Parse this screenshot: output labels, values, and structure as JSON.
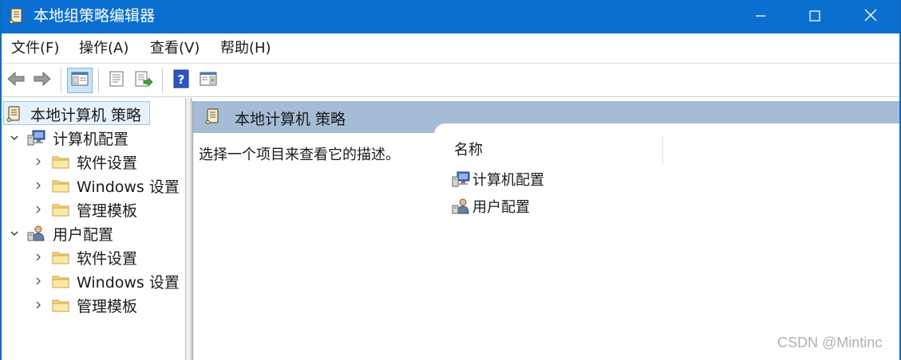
{
  "window": {
    "title": "本地组策略编辑器",
    "accent": "#0b6fd1",
    "controls": {
      "minimize": "minimize-icon",
      "maximize": "maximize-icon",
      "close": "close-icon"
    }
  },
  "menu": {
    "items": [
      "文件(F)",
      "操作(A)",
      "查看(V)",
      "帮助(H)"
    ]
  },
  "toolbar": {
    "buttons": [
      "back-arrow-icon",
      "forward-arrow-icon",
      "show-hide-tree-icon",
      "properties-icon",
      "export-list-icon",
      "help-icon",
      "action-pane-icon"
    ]
  },
  "tree": {
    "root": {
      "label": "本地计算机 策略",
      "icon": "policy-scroll-icon"
    },
    "nodes": [
      {
        "label": "计算机配置",
        "icon": "computer-config-icon",
        "expanded": true,
        "children": [
          {
            "label": "软件设置",
            "icon": "folder-icon"
          },
          {
            "label": "Windows 设置",
            "icon": "folder-icon"
          },
          {
            "label": "管理模板",
            "icon": "folder-icon"
          }
        ]
      },
      {
        "label": "用户配置",
        "icon": "user-config-icon",
        "expanded": true,
        "children": [
          {
            "label": "软件设置",
            "icon": "folder-icon"
          },
          {
            "label": "Windows 设置",
            "icon": "folder-icon"
          },
          {
            "label": "管理模板",
            "icon": "folder-icon"
          }
        ]
      }
    ]
  },
  "content": {
    "header_title": "本地计算机 策略",
    "description": "选择一个项目来查看它的描述。",
    "column_name": "名称",
    "items": [
      {
        "label": "计算机配置",
        "icon": "computer-config-icon"
      },
      {
        "label": "用户配置",
        "icon": "user-config-icon"
      }
    ],
    "header_color": "#a5bcd6"
  },
  "watermark": "CSDN @Mintinc"
}
